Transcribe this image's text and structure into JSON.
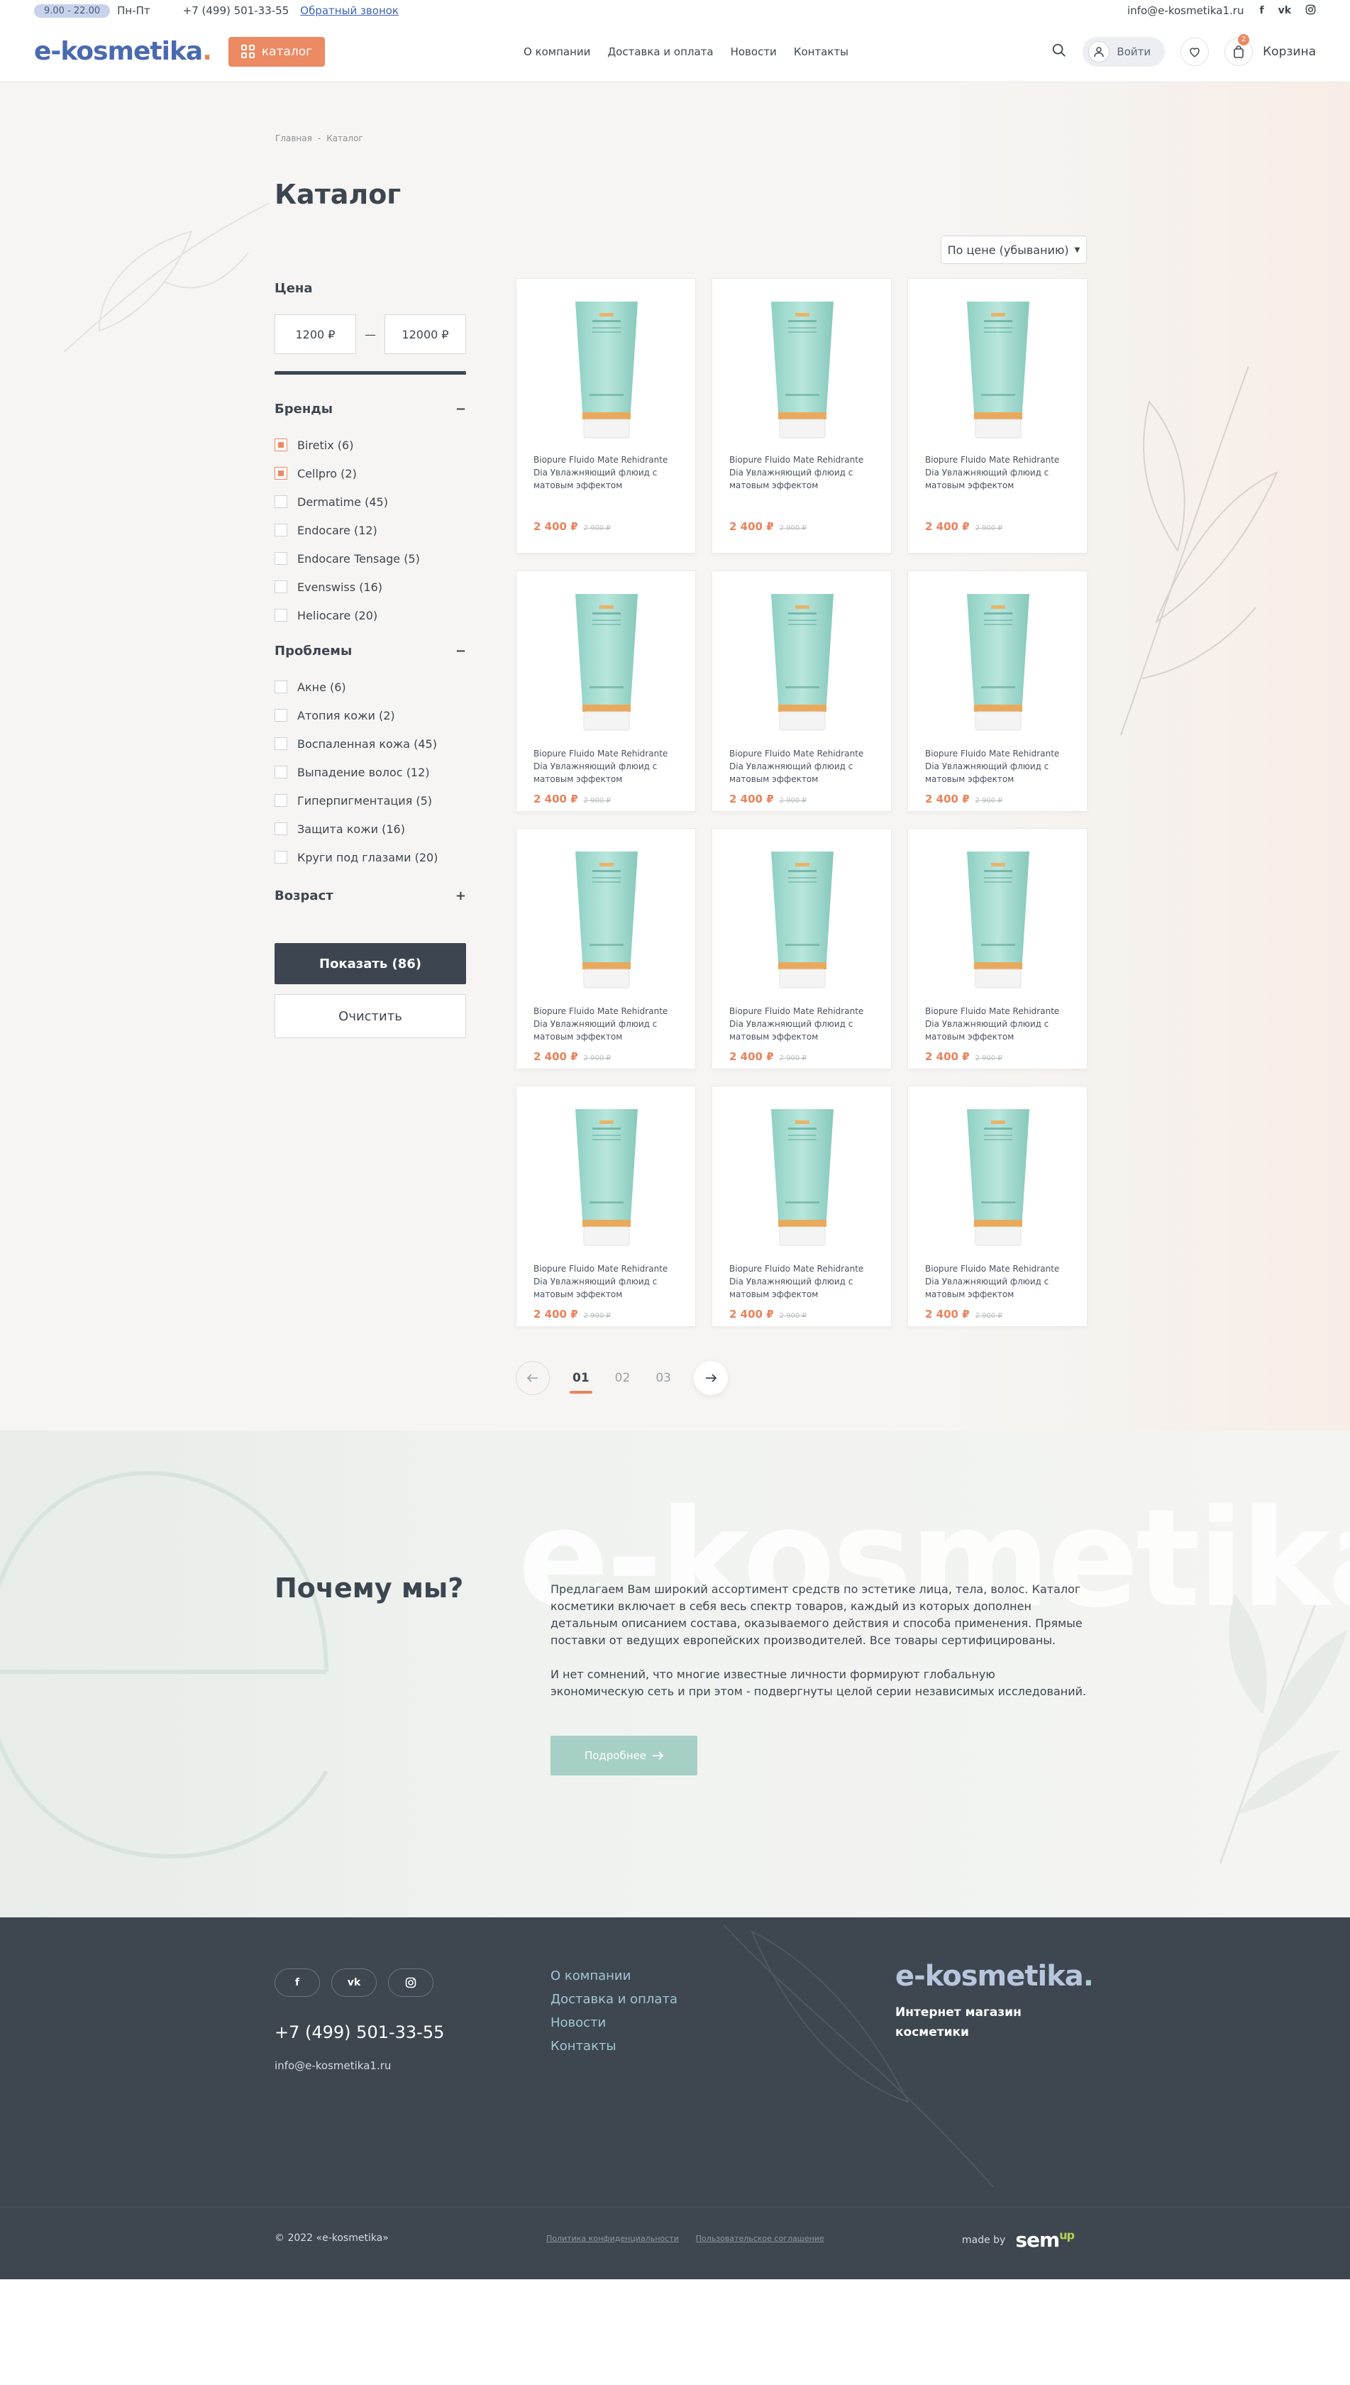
{
  "topbar": {
    "hours": "9.00 - 22.00",
    "days": "Пн-Пт",
    "phone": "+7 (499) 501-33-55",
    "callback": "Обратный звонок",
    "email": "info@e-kosmetika1.ru",
    "social": [
      "facebook-icon",
      "vk-icon",
      "instagram-icon"
    ]
  },
  "header": {
    "logo": "e-kosmetika",
    "catalog_label": "каталог",
    "nav": [
      "О компании",
      "Доставка и оплата",
      "Новости",
      "Контакты"
    ],
    "login_label": "Войти",
    "cart_label": "Корзина",
    "cart_count": "2",
    "accent_color": "#eb8a63",
    "brand_color": "#4a6ab0"
  },
  "breadcrumb": [
    "Главная",
    "Каталог"
  ],
  "page_title": "Каталог",
  "sort_label": "По цене (убыванию)",
  "filters": {
    "price": {
      "title": "Цена",
      "min": "1200 ₽",
      "max": "12000 ₽",
      "separator": "—"
    },
    "brands": {
      "title": "Бренды",
      "toggle": "−",
      "items": [
        {
          "label": "Biretix (6)",
          "checked": true
        },
        {
          "label": "Cellpro (2)",
          "checked": true
        },
        {
          "label": "Dermatime (45)",
          "checked": false
        },
        {
          "label": "Endocare (12)",
          "checked": false
        },
        {
          "label": "Endocare Tensage (5)",
          "checked": false
        },
        {
          "label": "Evenswiss (16)",
          "checked": false
        },
        {
          "label": "Heliocare (20)",
          "checked": false
        }
      ]
    },
    "problems": {
      "title": "Проблемы",
      "toggle": "−",
      "items": [
        {
          "label": "Акне (6)",
          "checked": false
        },
        {
          "label": "Атопия кожи (2)",
          "checked": false
        },
        {
          "label": "Воспаленная кожа (45)",
          "checked": false
        },
        {
          "label": "Выпадение волос (12)",
          "checked": false
        },
        {
          "label": "Гиперпигментация (5)",
          "checked": false
        },
        {
          "label": "Защита кожи (16)",
          "checked": false
        },
        {
          "label": "Круги под глазами (20)",
          "checked": false
        }
      ]
    },
    "age": {
      "title": "Возраст",
      "toggle": "+"
    },
    "show_label": "Показать (86)",
    "clear_label": "Очистить"
  },
  "products": [
    {
      "name": "Biopure Fluido Mate Rehidrante Dia Увлажняющий флюид с матовым эффектом",
      "price": "2 400 ₽",
      "old_price": "2 900 ₽"
    },
    {
      "name": "Biopure Fluido Mate Rehidrante Dia Увлажняющий флюид с матовым эффектом",
      "price": "2 400 ₽",
      "old_price": "2 900 ₽"
    },
    {
      "name": "Biopure Fluido Mate Rehidrante Dia Увлажняющий флюид с матовым эффектом",
      "price": "2 400 ₽",
      "old_price": "2 900 ₽"
    },
    {
      "name": "Biopure Fluido Mate Rehidrante Dia Увлажняющий флюид с матовым эффектом",
      "price": "2 400 ₽",
      "old_price": "2 900 ₽"
    },
    {
      "name": "Biopure Fluido Mate Rehidrante Dia Увлажняющий флюид с матовым эффектом",
      "price": "2 400 ₽",
      "old_price": "2 900 ₽"
    },
    {
      "name": "Biopure Fluido Mate Rehidrante Dia Увлажняющий флюид с матовым эффектом",
      "price": "2 400 ₽",
      "old_price": "2 900 ₽"
    },
    {
      "name": "Biopure Fluido Mate Rehidrante Dia Увлажняющий флюид с матовым эффектом",
      "price": "2 400 ₽",
      "old_price": "2 900 ₽"
    },
    {
      "name": "Biopure Fluido Mate Rehidrante Dia Увлажняющий флюид с матовым эффектом",
      "price": "2 400 ₽",
      "old_price": "2 900 ₽"
    },
    {
      "name": "Biopure Fluido Mate Rehidrante Dia Увлажняющий флюид с матовым эффектом",
      "price": "2 400 ₽",
      "old_price": "2 900 ₽"
    },
    {
      "name": "Biopure Fluido Mate Rehidrante Dia Увлажняющий флюид с матовым эффектом",
      "price": "2 400 ₽",
      "old_price": "2 900 ₽"
    },
    {
      "name": "Biopure Fluido Mate Rehidrante Dia Увлажняющий флюид с матовым эффектом",
      "price": "2 400 ₽",
      "old_price": "2 900 ₽"
    },
    {
      "name": "Biopure Fluido Mate Rehidrante Dia Увлажняющий флюид с матовым эффектом",
      "price": "2 400 ₽",
      "old_price": "2 900 ₽"
    }
  ],
  "pagination": {
    "pages": [
      "01",
      "02",
      "03"
    ],
    "active": "01"
  },
  "why": {
    "watermark": "e-kosmetika.",
    "title": "Почему мы?",
    "p1": "Предлагаем Вам широкий ассортимент средств по эстетике лица, тела, волос. Каталог косметики включает в себя весь спектр товаров, каждый из которых дополнен детальным описанием состава, оказываемого действия и способа применения. Прямые поставки от ведущих европейских производителей. Все товары сертифицированы.",
    "p2": "И нет сомнений, что многие известные личности формируют глобальную экономическую сеть и при этом - подвергнуты целой серии независимых исследований.",
    "more_label": "Подробнее"
  },
  "footer": {
    "social": [
      "f",
      "vk",
      "ig"
    ],
    "phone": "+7 (499) 501-33-55",
    "email": "info@e-kosmetika1.ru",
    "nav": [
      "О компании",
      "Доставка и оплата",
      "Новости",
      "Контакты"
    ],
    "logo": "e-kosmetika",
    "slogan": "Интернет магазин косметики",
    "copyright": "© 2022 «e-kosmetika»",
    "privacy": "Политика конфиденциальности",
    "terms": "Пользовательское соглашение",
    "made_by": "made by",
    "made_by_brand": "sem",
    "made_by_sup": "up"
  }
}
